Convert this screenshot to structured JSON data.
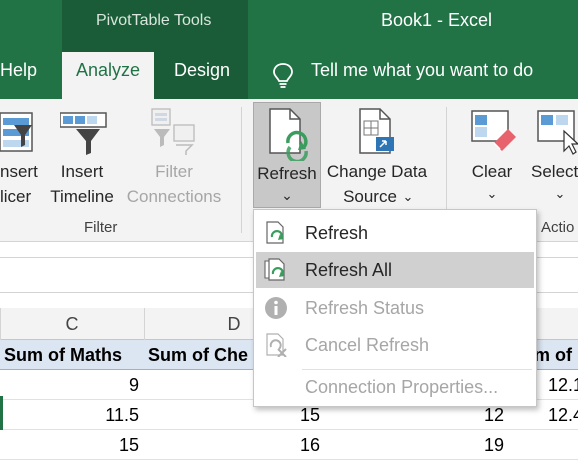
{
  "titlebar": {
    "context_tab_group": "PivotTable Tools",
    "window_title": "Book1  -  Excel"
  },
  "tabs": {
    "help": "Help",
    "analyze": "Analyze",
    "design": "Design",
    "tell_me": "Tell me what you want to do"
  },
  "ribbon": {
    "insert_slicer": [
      "nsert",
      "licer"
    ],
    "insert_timeline": [
      "Insert",
      "Timeline"
    ],
    "filter_connections": [
      "Filter",
      "Connections"
    ],
    "filter_group": "Filter",
    "refresh": "Refresh",
    "change_data_source": [
      "Change Data",
      "Source"
    ],
    "clear": "Clear",
    "select": "Select",
    "actions_group": "Actio",
    "dropdown_arrow": "⌄"
  },
  "menu": {
    "refresh": "Refresh",
    "refresh_all": "Refresh All",
    "refresh_status": "Refresh Status",
    "cancel_refresh": "Cancel Refresh",
    "connection_properties": "Connection Properties..."
  },
  "columns": {
    "c": "C",
    "d": "D"
  },
  "grid": {
    "headers": [
      "Sum of Maths",
      "Sum of Che",
      "m of"
    ],
    "rows": [
      {
        "c": "9",
        "d": "",
        "e": "",
        "f": "12.1"
      },
      {
        "c": "11.5",
        "d": "15",
        "e": "12",
        "f": "12.4"
      },
      {
        "c": "15",
        "d": "16",
        "e": "19",
        "f": ""
      }
    ]
  },
  "colors": {
    "excel_green": "#217346",
    "context_green": "#1a5c37",
    "ribbon_bg": "#f3f3f3",
    "pivot_header": "#dce6f2",
    "refresh_icon_green": "#3a9d5d"
  }
}
